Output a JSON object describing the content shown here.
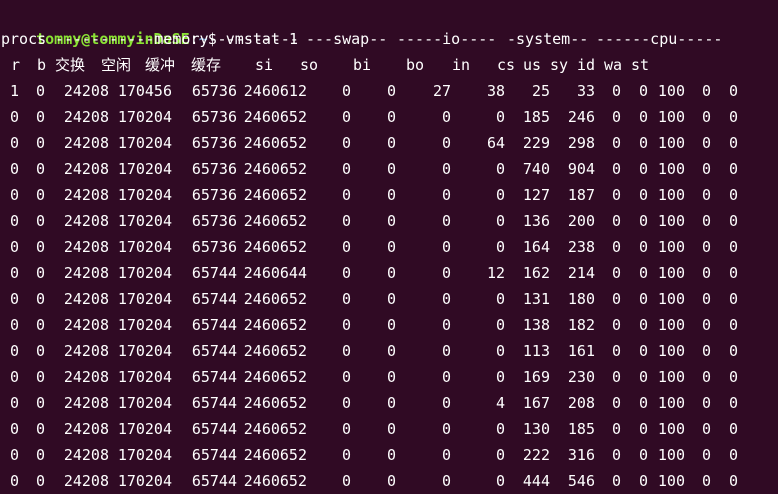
{
  "prompt": {
    "user_host": "tommy@tommyinDaSE",
    "separator": ":",
    "path": "~",
    "dollar": "$",
    "command": "vmstat 1"
  },
  "group_header": {
    "procs": "procs",
    "memory": "-----------memory----------",
    "swap": "---swap--",
    "io": "-----io----",
    "system": "-system--",
    "cpu": "------cpu-----"
  },
  "columns": [
    "r",
    "b",
    "交换",
    "空闲",
    "缓冲",
    "缓存",
    "si",
    "so",
    "bi",
    "bo",
    "in",
    "cs",
    "us",
    "sy",
    "id",
    "wa",
    "st"
  ],
  "rows": [
    [
      "1",
      "0",
      "24208",
      "170456",
      "65736",
      "2460612",
      "0",
      "0",
      "27",
      "38",
      "25",
      "33",
      "0",
      "0",
      "100",
      "0",
      "0"
    ],
    [
      "0",
      "0",
      "24208",
      "170204",
      "65736",
      "2460652",
      "0",
      "0",
      "0",
      "0",
      "185",
      "246",
      "0",
      "0",
      "100",
      "0",
      "0"
    ],
    [
      "0",
      "0",
      "24208",
      "170204",
      "65736",
      "2460652",
      "0",
      "0",
      "0",
      "64",
      "229",
      "298",
      "0",
      "0",
      "100",
      "0",
      "0"
    ],
    [
      "0",
      "0",
      "24208",
      "170204",
      "65736",
      "2460652",
      "0",
      "0",
      "0",
      "0",
      "740",
      "904",
      "0",
      "0",
      "100",
      "0",
      "0"
    ],
    [
      "0",
      "0",
      "24208",
      "170204",
      "65736",
      "2460652",
      "0",
      "0",
      "0",
      "0",
      "127",
      "187",
      "0",
      "0",
      "100",
      "0",
      "0"
    ],
    [
      "0",
      "0",
      "24208",
      "170204",
      "65736",
      "2460652",
      "0",
      "0",
      "0",
      "0",
      "136",
      "200",
      "0",
      "0",
      "100",
      "0",
      "0"
    ],
    [
      "0",
      "0",
      "24208",
      "170204",
      "65736",
      "2460652",
      "0",
      "0",
      "0",
      "0",
      "164",
      "238",
      "0",
      "0",
      "100",
      "0",
      "0"
    ],
    [
      "0",
      "0",
      "24208",
      "170204",
      "65744",
      "2460644",
      "0",
      "0",
      "0",
      "12",
      "162",
      "214",
      "0",
      "0",
      "100",
      "0",
      "0"
    ],
    [
      "0",
      "0",
      "24208",
      "170204",
      "65744",
      "2460652",
      "0",
      "0",
      "0",
      "0",
      "131",
      "180",
      "0",
      "0",
      "100",
      "0",
      "0"
    ],
    [
      "0",
      "0",
      "24208",
      "170204",
      "65744",
      "2460652",
      "0",
      "0",
      "0",
      "0",
      "138",
      "182",
      "0",
      "0",
      "100",
      "0",
      "0"
    ],
    [
      "0",
      "0",
      "24208",
      "170204",
      "65744",
      "2460652",
      "0",
      "0",
      "0",
      "0",
      "113",
      "161",
      "0",
      "0",
      "100",
      "0",
      "0"
    ],
    [
      "0",
      "0",
      "24208",
      "170204",
      "65744",
      "2460652",
      "0",
      "0",
      "0",
      "0",
      "169",
      "230",
      "0",
      "0",
      "100",
      "0",
      "0"
    ],
    [
      "0",
      "0",
      "24208",
      "170204",
      "65744",
      "2460652",
      "0",
      "0",
      "0",
      "4",
      "167",
      "208",
      "0",
      "0",
      "100",
      "0",
      "0"
    ],
    [
      "0",
      "0",
      "24208",
      "170204",
      "65744",
      "2460652",
      "0",
      "0",
      "0",
      "0",
      "130",
      "185",
      "0",
      "0",
      "100",
      "0",
      "0"
    ],
    [
      "0",
      "0",
      "24208",
      "170204",
      "65744",
      "2460652",
      "0",
      "0",
      "0",
      "0",
      "222",
      "316",
      "0",
      "0",
      "100",
      "0",
      "0"
    ],
    [
      "0",
      "0",
      "24208",
      "170204",
      "65744",
      "2460652",
      "0",
      "0",
      "0",
      "0",
      "444",
      "546",
      "0",
      "0",
      "100",
      "0",
      "0"
    ]
  ],
  "colors": {
    "background": "#300a24",
    "foreground": "#ffffff",
    "prompt_user": "#8ae234",
    "prompt_path": "#729fcf"
  }
}
